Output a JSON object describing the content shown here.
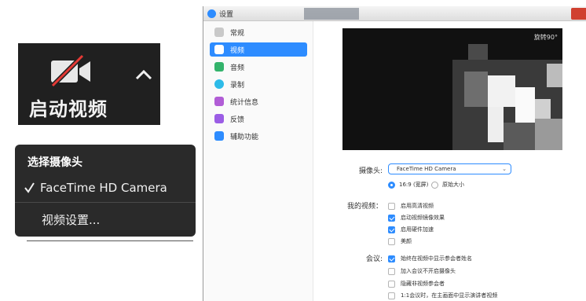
{
  "video_button": {
    "label": "启动视频",
    "icon": "camera-off-icon",
    "caret_icon": "chevron-up-icon"
  },
  "camera_menu": {
    "header": "选择摄像头",
    "items": [
      {
        "label": "FaceTime HD Camera",
        "checked": true
      }
    ],
    "settings_label": "视频设置..."
  },
  "settings_window": {
    "title": "设置",
    "sidebar": [
      {
        "label": "常规",
        "icon": "gear-icon",
        "color": "#c9c9c9",
        "active": false
      },
      {
        "label": "视频",
        "icon": "video-camera-icon",
        "color": "#2d8cff",
        "active": true
      },
      {
        "label": "音频",
        "icon": "headphones-icon",
        "color": "#33b36b",
        "active": false
      },
      {
        "label": "录制",
        "icon": "record-icon",
        "color": "#2dbbe8",
        "active": false
      },
      {
        "label": "统计信息",
        "icon": "stats-icon",
        "color": "#b15dd6",
        "active": false
      },
      {
        "label": "反馈",
        "icon": "feedback-icon",
        "color": "#9b5de5",
        "active": false
      },
      {
        "label": "辅助功能",
        "icon": "accessibility-icon",
        "color": "#2d8cff",
        "active": false
      }
    ],
    "preview": {
      "rotate_label": "旋转90°"
    },
    "camera": {
      "label": "摄像头:",
      "selected": "FaceTime HD Camera"
    },
    "aspect": {
      "options": [
        {
          "label": "16:9 (宽屏)",
          "selected": true
        },
        {
          "label": "原始大小",
          "selected": false
        }
      ]
    },
    "my_video": {
      "label": "我的视频：",
      "options": [
        {
          "label": "启用高清视频",
          "checked": false
        },
        {
          "label": "启动视频镜像效果",
          "checked": true
        },
        {
          "label": "启用硬件加速",
          "checked": true
        },
        {
          "label": "美颜",
          "checked": false
        }
      ]
    },
    "meeting": {
      "label": "会议:",
      "options": [
        {
          "label": "始终在视频中显示参会者姓名",
          "checked": true
        },
        {
          "label": "加入会议不开启摄像头",
          "checked": false
        },
        {
          "label": "隐藏非视频参会者",
          "checked": false
        },
        {
          "label": "1:1会议时，在主画面中显示演讲者视频",
          "checked": false
        }
      ]
    },
    "colors": {
      "accent": "#2d8cff",
      "checkbox_on": "#2d8cff"
    }
  }
}
